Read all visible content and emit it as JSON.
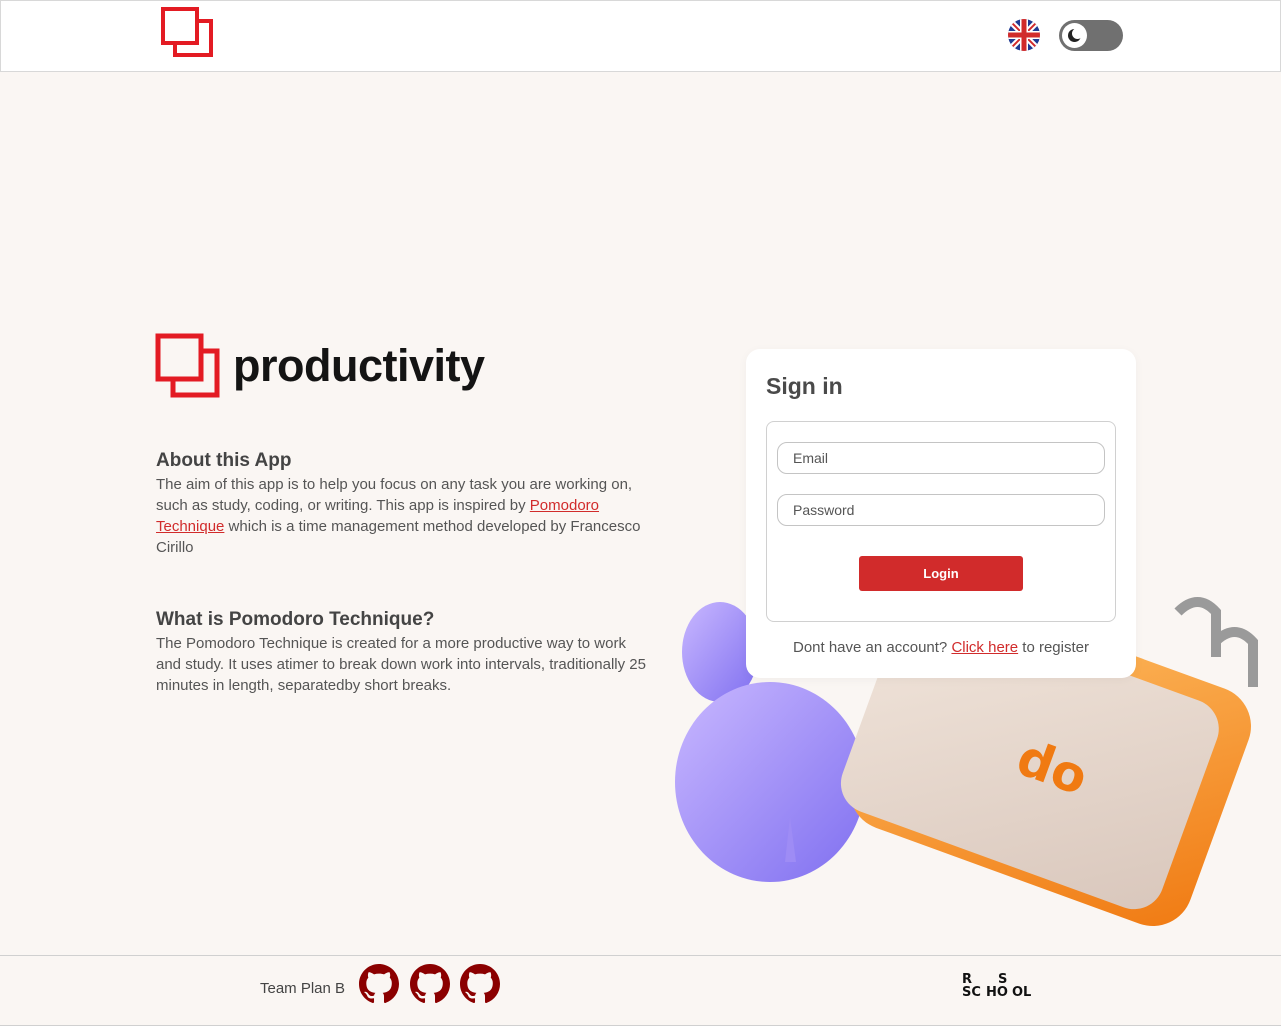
{
  "header": {
    "logo_icon": "productivity-logo-icon",
    "language_icon": "uk-flag-icon",
    "theme_toggle_icon": "moon-icon"
  },
  "brand": {
    "name": "productivity"
  },
  "about": {
    "title": "About this App",
    "text_before_link": "The aim of this app is to help you focus on any task you are working on, such as study, coding, or writing. This app is inspired by ",
    "link_text": "Pomodoro Technique",
    "text_after_link": " which is a time management method developed by Francesco Cirillo"
  },
  "pomodoro": {
    "title": "What is Pomodoro Technique?",
    "text": "The Pomodoro Technique is created for a more productive way to work and study. It uses atimer to break down work into intervals, traditionally 25 minutes in length, separatedby short breaks."
  },
  "signin": {
    "title": "Sign in",
    "email_placeholder": "Email",
    "email_value": "",
    "password_placeholder": "Password",
    "password_value": "",
    "login_label": "Login",
    "register_prefix": "Dont have an account? ",
    "register_link": "Click here",
    "register_suffix": " to register"
  },
  "footer": {
    "team_label": "Team Plan B",
    "github_icon": "github-icon",
    "rs_letters": [
      "R",
      "S",
      "SC",
      "HO",
      "OL"
    ]
  },
  "colors": {
    "accent": "#d12b2b",
    "background": "#faf6f3",
    "github": "#8b0000"
  }
}
